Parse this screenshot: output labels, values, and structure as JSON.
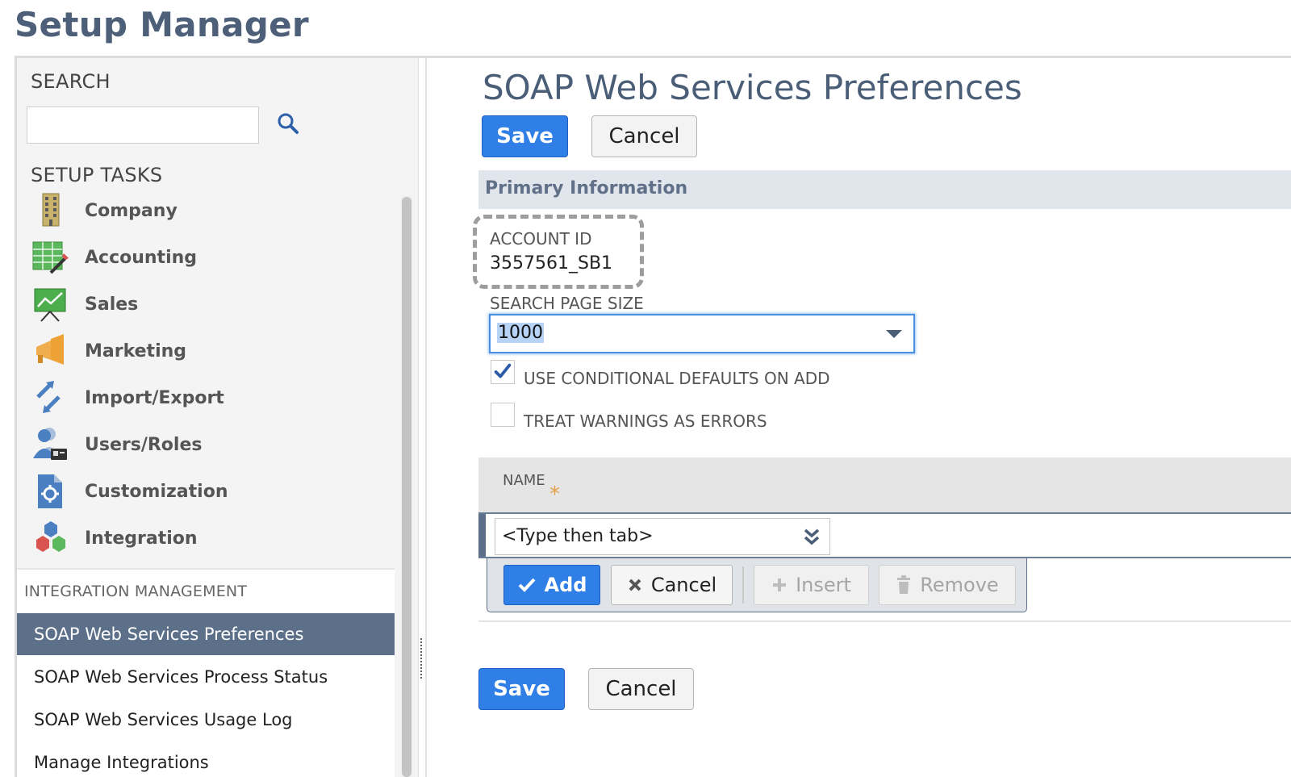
{
  "app": {
    "title": "Setup Manager"
  },
  "sidebar": {
    "search_heading": "SEARCH",
    "search_value": "",
    "tasks_heading": "SETUP TASKS",
    "tasks": [
      {
        "label": "Company",
        "icon": "building-icon"
      },
      {
        "label": "Accounting",
        "icon": "ledger-icon"
      },
      {
        "label": "Sales",
        "icon": "sales-chart-icon"
      },
      {
        "label": "Marketing",
        "icon": "megaphone-icon"
      },
      {
        "label": "Import/Export",
        "icon": "import-export-arrows-icon"
      },
      {
        "label": "Users/Roles",
        "icon": "users-roles-icon"
      },
      {
        "label": "Customization",
        "icon": "customization-gear-icon"
      },
      {
        "label": "Integration",
        "icon": "integration-hexagons-icon"
      }
    ],
    "management_heading": "INTEGRATION MANAGEMENT",
    "management_items": [
      "SOAP Web Services Preferences",
      "SOAP Web Services Process Status",
      "SOAP Web Services Usage Log",
      "Manage Integrations"
    ],
    "active_item": "SOAP Web Services Preferences"
  },
  "main": {
    "title": "SOAP Web Services Preferences",
    "buttons": {
      "save": "Save",
      "cancel": "Cancel"
    },
    "section": "Primary Information",
    "account_id_label": "ACCOUNT ID",
    "account_id_value": "3557561_SB1",
    "page_size_label": "SEARCH PAGE SIZE",
    "page_size_value": "1000",
    "checkboxes": [
      {
        "label": "USE CONDITIONAL DEFAULTS ON ADD",
        "checked": true
      },
      {
        "label": "TREAT WARNINGS AS ERRORS",
        "checked": false
      }
    ],
    "sublist": {
      "column_name": "NAME",
      "required_mark": "*",
      "name_placeholder": "<Type then tab>",
      "add": "Add",
      "cancel": "Cancel",
      "insert": "Insert",
      "remove": "Remove"
    }
  },
  "colors": {
    "title": "#4d5f79",
    "primary_button": "#2f7fe6",
    "active_nav": "#5d7089",
    "section_bar": "#e1e5ec",
    "required_star": "#e3a04a"
  }
}
